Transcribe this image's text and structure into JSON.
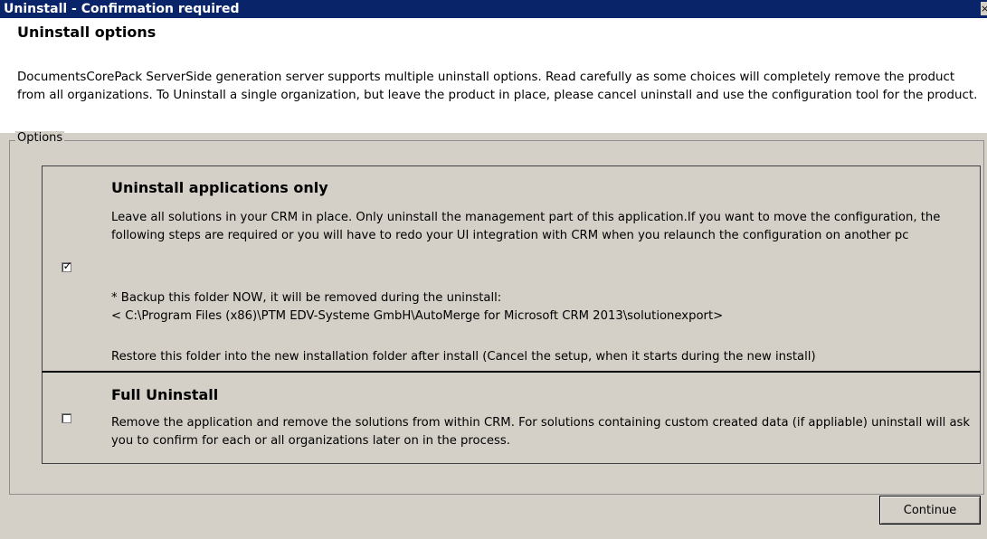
{
  "window": {
    "title": "Uninstall - Confirmation required",
    "close_glyph": "×"
  },
  "header": {
    "heading": "Uninstall options",
    "description": "DocumentsCorePack ServerSide generation server supports multiple uninstall options. Read carefully as some choices will completely remove the product from all organizations. To Uninstall a single organization, but leave the product in place, please cancel uninstall and use the configuration tool for the product."
  },
  "options": {
    "legend": "Options",
    "apps_only": {
      "title": "Uninstall applications only",
      "checked": true,
      "text1": "Leave all solutions in your CRM in place. Only uninstall the management part of this application.If you want to move the configuration, the following steps are required or you will have to redo your UI integration with CRM when you relaunch the configuration on another pc",
      "text2": "* Backup this folder NOW, it will be removed during the uninstall:",
      "text3": "< C:\\Program Files (x86)\\PTM EDV-Systeme GmbH\\AutoMerge for Microsoft CRM 2013\\solutionexport>",
      "text4": "Restore this folder into the new installation folder after install (Cancel the setup, when it starts during the new install)"
    },
    "full": {
      "title": "Full Uninstall",
      "checked": false,
      "text": "Remove the application and remove the solutions from within CRM. For solutions containing custom created data (if appliable) uninstall will ask you to confirm for each or all organizations later on in the process."
    }
  },
  "footer": {
    "continue_label": "Continue"
  },
  "colors": {
    "titlebar": "#0a246a",
    "dialog_bg": "#d4d0c8",
    "header_bg": "#ffffff"
  }
}
